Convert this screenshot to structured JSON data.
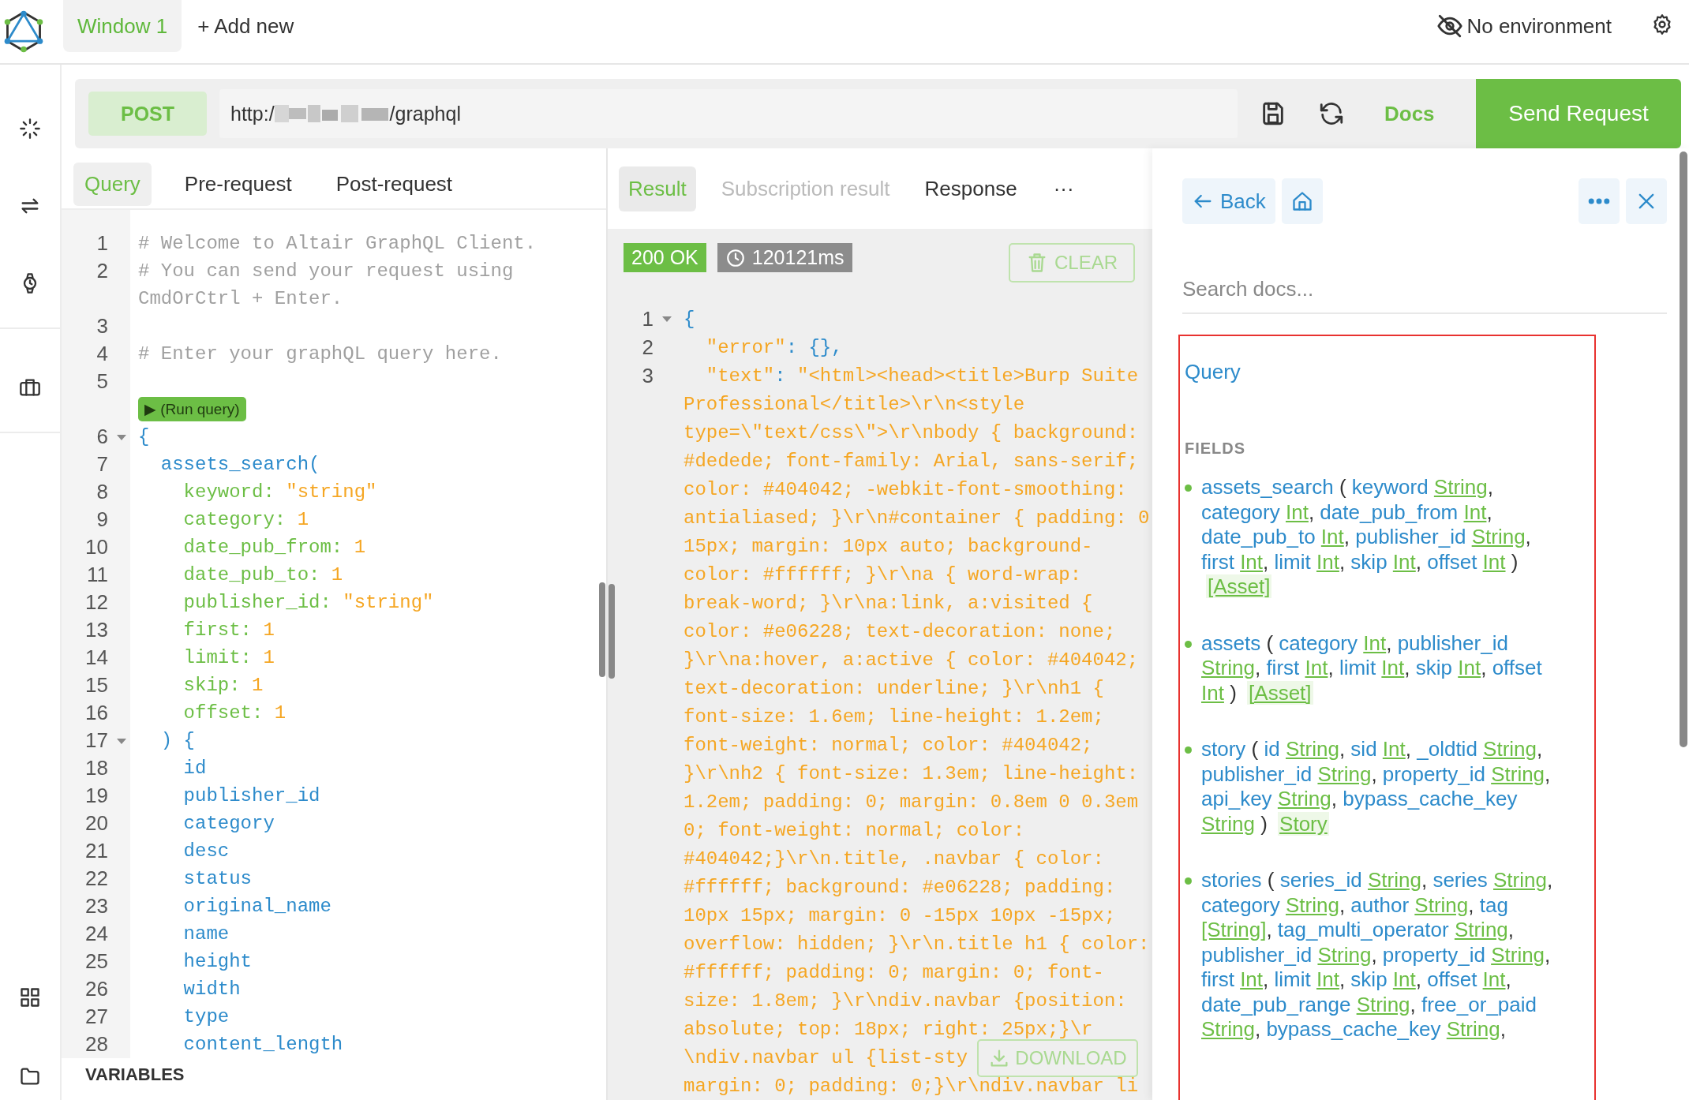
{
  "header": {
    "window_tabs": [
      {
        "label": "Window 1",
        "selected": true
      }
    ],
    "add_label": "+ Add new",
    "environment": "No environment"
  },
  "request": {
    "method": "POST",
    "url_start": "http:/",
    "url_end": "/graphql",
    "docs_label": "Docs",
    "send_label": "Send Request"
  },
  "query_pane": {
    "tabs": [
      {
        "label": "Query",
        "selected": true
      },
      {
        "label": "Pre-request",
        "selected": false
      },
      {
        "label": "Post-request",
        "selected": false
      }
    ],
    "rows": [
      {
        "kind": "code",
        "number": "1",
        "fold": false,
        "parts": [
          {
            "kind": "comment",
            "text": "# Welcome to Altair GraphQL Client."
          }
        ]
      },
      {
        "kind": "code",
        "number": "2",
        "fold": false,
        "parts": [
          {
            "kind": "comment",
            "text": "# You can send your request using"
          }
        ]
      },
      {
        "kind": "code",
        "fold": false,
        "parts": [
          {
            "kind": "comment",
            "text": "CmdOrCtrl + Enter."
          }
        ]
      },
      {
        "kind": "code",
        "number": "3",
        "fold": false,
        "parts": []
      },
      {
        "kind": "code",
        "number": "4",
        "fold": false,
        "parts": [
          {
            "kind": "comment",
            "text": "# Enter your graphQL query here."
          }
        ]
      },
      {
        "kind": "code",
        "number": "5",
        "fold": false,
        "parts": []
      },
      {
        "kind": "run",
        "label": "▶ (Run query)"
      },
      {
        "kind": "code",
        "number": "6",
        "fold": true,
        "parts": [
          {
            "kind": "name",
            "text": "{"
          }
        ]
      },
      {
        "kind": "code",
        "number": "7",
        "fold": false,
        "parts": [
          {
            "kind": "name",
            "text": "  assets_search("
          }
        ]
      },
      {
        "kind": "code",
        "number": "8",
        "fold": false,
        "parts": [
          {
            "kind": "field",
            "text": "    keyword: "
          },
          {
            "kind": "literal",
            "text": "\"string\""
          }
        ]
      },
      {
        "kind": "code",
        "number": "9",
        "fold": false,
        "parts": [
          {
            "kind": "field",
            "text": "    category: "
          },
          {
            "kind": "literal",
            "text": "1"
          }
        ]
      },
      {
        "kind": "code",
        "number": "10",
        "fold": false,
        "parts": [
          {
            "kind": "field",
            "text": "    date_pub_from: "
          },
          {
            "kind": "literal",
            "text": "1"
          }
        ]
      },
      {
        "kind": "code",
        "number": "11",
        "fold": false,
        "parts": [
          {
            "kind": "field",
            "text": "    date_pub_to: "
          },
          {
            "kind": "literal",
            "text": "1"
          }
        ]
      },
      {
        "kind": "code",
        "number": "12",
        "fold": false,
        "parts": [
          {
            "kind": "field",
            "text": "    publisher_id: "
          },
          {
            "kind": "literal",
            "text": "\"string\""
          }
        ]
      },
      {
        "kind": "code",
        "number": "13",
        "fold": false,
        "parts": [
          {
            "kind": "field",
            "text": "    first: "
          },
          {
            "kind": "literal",
            "text": "1"
          }
        ]
      },
      {
        "kind": "code",
        "number": "14",
        "fold": false,
        "parts": [
          {
            "kind": "field",
            "text": "    limit: "
          },
          {
            "kind": "literal",
            "text": "1"
          }
        ]
      },
      {
        "kind": "code",
        "number": "15",
        "fold": false,
        "parts": [
          {
            "kind": "field",
            "text": "    skip: "
          },
          {
            "kind": "literal",
            "text": "1"
          }
        ]
      },
      {
        "kind": "code",
        "number": "16",
        "fold": false,
        "parts": [
          {
            "kind": "field",
            "text": "    offset: "
          },
          {
            "kind": "literal",
            "text": "1"
          }
        ]
      },
      {
        "kind": "code",
        "number": "17",
        "fold": true,
        "parts": [
          {
            "kind": "name",
            "text": "  ) {"
          }
        ]
      },
      {
        "kind": "code",
        "number": "18",
        "fold": false,
        "parts": [
          {
            "kind": "name",
            "text": "    id"
          }
        ]
      },
      {
        "kind": "code",
        "number": "19",
        "fold": false,
        "parts": [
          {
            "kind": "name",
            "text": "    publisher_id"
          }
        ]
      },
      {
        "kind": "code",
        "number": "20",
        "fold": false,
        "parts": [
          {
            "kind": "name",
            "text": "    category"
          }
        ]
      },
      {
        "kind": "code",
        "number": "21",
        "fold": false,
        "parts": [
          {
            "kind": "name",
            "text": "    desc"
          }
        ]
      },
      {
        "kind": "code",
        "number": "22",
        "fold": false,
        "parts": [
          {
            "kind": "name",
            "text": "    status"
          }
        ]
      },
      {
        "kind": "code",
        "number": "23",
        "fold": false,
        "parts": [
          {
            "kind": "name",
            "text": "    original_name"
          }
        ]
      },
      {
        "kind": "code",
        "number": "24",
        "fold": false,
        "parts": [
          {
            "kind": "name",
            "text": "    name"
          }
        ]
      },
      {
        "kind": "code",
        "number": "25",
        "fold": false,
        "parts": [
          {
            "kind": "name",
            "text": "    height"
          }
        ]
      },
      {
        "kind": "code",
        "number": "26",
        "fold": false,
        "parts": [
          {
            "kind": "name",
            "text": "    width"
          }
        ]
      },
      {
        "kind": "code",
        "number": "27",
        "fold": false,
        "parts": [
          {
            "kind": "name",
            "text": "    type"
          }
        ]
      },
      {
        "kind": "code",
        "number": "28",
        "fold": false,
        "parts": [
          {
            "kind": "name",
            "text": "    content_length"
          }
        ]
      }
    ],
    "variables_label": "VARIABLES"
  },
  "result_pane": {
    "tabs": [
      {
        "label": "Result",
        "selected": true,
        "disabled": false
      },
      {
        "label": "Subscription result",
        "selected": false,
        "disabled": true
      },
      {
        "label": "Response",
        "selected": false,
        "disabled": false
      }
    ],
    "more_label": "···",
    "status": "200 OK",
    "time": "120121ms",
    "clear_label": "CLEAR",
    "download_label": "DOWNLOAD",
    "rows": [
      {
        "kind": "code",
        "number": "1",
        "fold": true,
        "parts": [
          {
            "kind": "name",
            "text": "{"
          }
        ]
      },
      {
        "kind": "code",
        "number": "2",
        "fold": false,
        "parts": [
          {
            "kind": "literal",
            "text": "  \"error\""
          },
          {
            "kind": "name",
            "text": ": {},"
          }
        ]
      },
      {
        "kind": "code",
        "number": "3",
        "fold": false,
        "parts": [
          {
            "kind": "literal",
            "text": "  \"text\""
          },
          {
            "kind": "name",
            "text": ": "
          },
          {
            "kind": "literal",
            "text": "\"<html><head><title>Burp Suite"
          }
        ]
      },
      {
        "kind": "code",
        "fold": false,
        "parts": [
          {
            "kind": "literal",
            "text": "Professional</title>\\r\\n<style"
          }
        ]
      },
      {
        "kind": "code",
        "fold": false,
        "parts": [
          {
            "kind": "literal",
            "text": "type=\\\"text/css\\\">\\r\\nbody { background:"
          }
        ]
      },
      {
        "kind": "code",
        "fold": false,
        "parts": [
          {
            "kind": "literal",
            "text": "#dedede; font-family: Arial, sans-serif;"
          }
        ]
      },
      {
        "kind": "code",
        "fold": false,
        "parts": [
          {
            "kind": "literal",
            "text": "color: #404042; -webkit-font-smoothing:"
          }
        ]
      },
      {
        "kind": "code",
        "fold": false,
        "parts": [
          {
            "kind": "literal",
            "text": "antialiased; }\\r\\n#container { padding: 0"
          }
        ]
      },
      {
        "kind": "code",
        "fold": false,
        "parts": [
          {
            "kind": "literal",
            "text": "15px; margin: 10px auto; background-"
          }
        ]
      },
      {
        "kind": "code",
        "fold": false,
        "parts": [
          {
            "kind": "literal",
            "text": "color: #ffffff; }\\r\\na { word-wrap:"
          }
        ]
      },
      {
        "kind": "code",
        "fold": false,
        "parts": [
          {
            "kind": "literal",
            "text": "break-word; }\\r\\na:link, a:visited {"
          }
        ]
      },
      {
        "kind": "code",
        "fold": false,
        "parts": [
          {
            "kind": "literal",
            "text": "color: #e06228; text-decoration: none;"
          }
        ]
      },
      {
        "kind": "code",
        "fold": false,
        "parts": [
          {
            "kind": "literal",
            "text": "}\\r\\na:hover, a:active { color: #404042;"
          }
        ]
      },
      {
        "kind": "code",
        "fold": false,
        "parts": [
          {
            "kind": "literal",
            "text": "text-decoration: underline; }\\r\\nh1 {"
          }
        ]
      },
      {
        "kind": "code",
        "fold": false,
        "parts": [
          {
            "kind": "literal",
            "text": "font-size: 1.6em; line-height: 1.2em;"
          }
        ]
      },
      {
        "kind": "code",
        "fold": false,
        "parts": [
          {
            "kind": "literal",
            "text": "font-weight: normal; color: #404042;"
          }
        ]
      },
      {
        "kind": "code",
        "fold": false,
        "parts": [
          {
            "kind": "literal",
            "text": "}\\r\\nh2 { font-size: 1.3em; line-height:"
          }
        ]
      },
      {
        "kind": "code",
        "fold": false,
        "parts": [
          {
            "kind": "literal",
            "text": "1.2em; padding: 0; margin: 0.8em 0 0.3em"
          }
        ]
      },
      {
        "kind": "code",
        "fold": false,
        "parts": [
          {
            "kind": "literal",
            "text": "0; font-weight: normal; color:"
          }
        ]
      },
      {
        "kind": "code",
        "fold": false,
        "parts": [
          {
            "kind": "literal",
            "text": "#404042;}\\r\\n.title, .navbar { color:"
          }
        ]
      },
      {
        "kind": "code",
        "fold": false,
        "parts": [
          {
            "kind": "literal",
            "text": "#ffffff; background: #e06228; padding:"
          }
        ]
      },
      {
        "kind": "code",
        "fold": false,
        "parts": [
          {
            "kind": "literal",
            "text": "10px 15px; margin: 0 -15px 10px -15px;"
          }
        ]
      },
      {
        "kind": "code",
        "fold": false,
        "parts": [
          {
            "kind": "literal",
            "text": "overflow: hidden; }\\r\\n.title h1 { color:"
          }
        ]
      },
      {
        "kind": "code",
        "fold": false,
        "parts": [
          {
            "kind": "literal",
            "text": "#ffffff; padding: 0; margin: 0; font-"
          }
        ]
      },
      {
        "kind": "code",
        "fold": false,
        "parts": [
          {
            "kind": "literal",
            "text": "size: 1.8em; }\\r\\ndiv.navbar {position:"
          }
        ]
      },
      {
        "kind": "code",
        "fold": false,
        "parts": [
          {
            "kind": "literal",
            "text": "absolute; top: 18px; right: 25px;}\\r"
          }
        ]
      },
      {
        "kind": "code",
        "fold": false,
        "parts": [
          {
            "kind": "literal",
            "text": "\\ndiv.navbar ul {list-sty"
          }
        ]
      },
      {
        "kind": "code",
        "fold": false,
        "parts": [
          {
            "kind": "literal",
            "text": "margin: 0; padding: 0;}\\r\\ndiv.navbar li"
          }
        ]
      }
    ]
  },
  "docs": {
    "back_label": "Back",
    "search_placeholder": "Search docs...",
    "type_name": "Query",
    "section": "FIELDS",
    "fields": [
      {
        "name": "assets_search",
        "open": "(",
        "close": ")",
        "returns": "[Asset]",
        "args": [
          {
            "name": "keyword",
            "type": "String",
            "sep": ","
          },
          {
            "name": "category",
            "type": "Int",
            "sep": ","
          },
          {
            "name": "date_pub_from",
            "type": "Int",
            "sep": ","
          },
          {
            "name": "date_pub_to",
            "type": "Int",
            "sep": ","
          },
          {
            "name": "publisher_id",
            "type": "String",
            "sep": ","
          },
          {
            "name": "first",
            "type": "Int",
            "sep": ","
          },
          {
            "name": "limit",
            "type": "Int",
            "sep": ","
          },
          {
            "name": "skip",
            "type": "Int",
            "sep": ","
          },
          {
            "name": "offset",
            "type": "Int"
          }
        ]
      },
      {
        "name": "assets",
        "open": "(",
        "close": ")",
        "returns": "[Asset]",
        "args": [
          {
            "name": "category",
            "type": "Int",
            "sep": ","
          },
          {
            "name": "publisher_id",
            "type": "String",
            "sep": ","
          },
          {
            "name": "first",
            "type": "Int",
            "sep": ","
          },
          {
            "name": "limit",
            "type": "Int",
            "sep": ","
          },
          {
            "name": "skip",
            "type": "Int",
            "sep": ","
          },
          {
            "name": "offset",
            "type": "Int"
          }
        ]
      },
      {
        "name": "story",
        "open": "(",
        "close": ")",
        "returns": "Story",
        "args": [
          {
            "name": "id",
            "type": "String",
            "sep": ","
          },
          {
            "name": "sid",
            "type": "Int",
            "sep": ","
          },
          {
            "name": "_oldtid",
            "type": "String",
            "sep": ","
          },
          {
            "name": "publisher_id",
            "type": "String",
            "sep": ","
          },
          {
            "name": "property_id",
            "type": "String",
            "sep": ","
          },
          {
            "name": "api_key",
            "type": "String",
            "sep": ","
          },
          {
            "name": "bypass_cache_key",
            "type": "String"
          }
        ]
      },
      {
        "name": "stories",
        "open": "(",
        "args": [
          {
            "name": "series_id",
            "type": "String",
            "sep": ","
          },
          {
            "name": "series",
            "type": "String",
            "sep": ","
          },
          {
            "name": "category",
            "type": "String",
            "sep": ","
          },
          {
            "name": "author",
            "type": "String",
            "sep": ","
          },
          {
            "name": "tag",
            "type": "[String]",
            "sep": ","
          },
          {
            "name": "tag_multi_operator",
            "type": "String",
            "sep": ","
          },
          {
            "name": "publisher_id",
            "type": "String",
            "sep": ","
          },
          {
            "name": "property_id",
            "type": "String",
            "sep": ","
          },
          {
            "name": "first",
            "type": "Int",
            "sep": ","
          },
          {
            "name": "limit",
            "type": "Int",
            "sep": ","
          },
          {
            "name": "skip",
            "type": "Int",
            "sep": ","
          },
          {
            "name": "offset",
            "type": "Int",
            "sep": ","
          },
          {
            "name": "date_pub_range",
            "type": "String",
            "sep": ","
          },
          {
            "name": "free_or_paid",
            "type": "String",
            "sep": ","
          },
          {
            "name": "bypass_cache_key",
            "type": "String",
            "sep": ","
          }
        ]
      }
    ]
  }
}
